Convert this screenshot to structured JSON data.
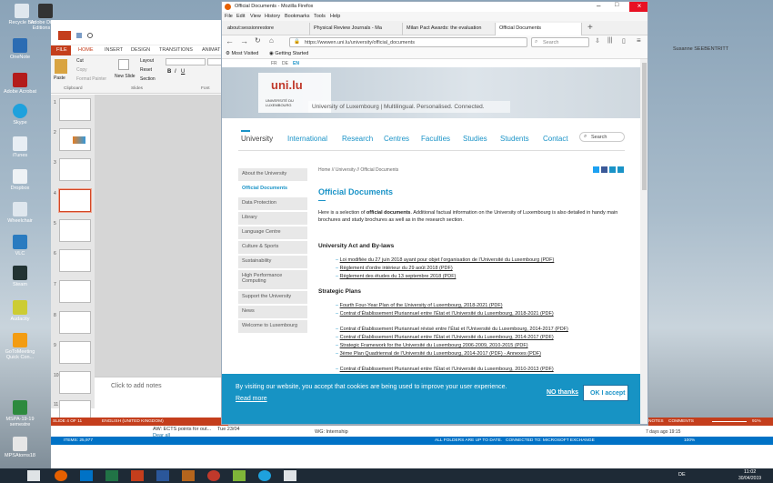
{
  "desktop": {
    "icons": [
      "Recycle Bin",
      "Adobe Digital Editions 4.5",
      "OneNote",
      "Adobe Acrobat",
      "Skype",
      "iTunes",
      "Dropbox",
      "Wheelchair",
      "VLC",
      "Steam",
      "Audacity",
      "GoToMeeting Quick Con...",
      "MSPA-19-19 semestre",
      "MPSAtorns18"
    ]
  },
  "ppt": {
    "tabs": [
      "FILE",
      "HOME",
      "INSERT",
      "DESIGN",
      "TRANSITIONS",
      "ANIMAT"
    ],
    "ribbon": {
      "paste": "Paste",
      "cut": "Cut",
      "copy": "Copy",
      "format_painter": "Format Painter",
      "new_slide": "New Slide",
      "layout": "Layout",
      "reset": "Reset",
      "section": "Section",
      "clipboard": "Clipboard",
      "slides": "Slides",
      "font": "Font"
    },
    "slide_numbers": [
      "1",
      "2",
      "3",
      "4",
      "5",
      "6",
      "7",
      "8",
      "9",
      "10",
      "11"
    ],
    "notes": "Click to add notes",
    "status": {
      "slide": "SLIDE 4 OF 11",
      "lang": "ENGLISH (UNITED KINGDOM)"
    }
  },
  "firefox": {
    "title": "Official Documents - Mozilla Firefox",
    "menu": [
      "File",
      "Edit",
      "View",
      "History",
      "Bookmarks",
      "Tools",
      "Help"
    ],
    "tabs": [
      "about:sessionrestore",
      "Physical Review Journals - Ma",
      "Milan Pact Awards: the evaluation",
      "Official Documents"
    ],
    "url": "https://wwwen.uni.lu/university/official_documents",
    "search_placeholder": "Search",
    "bookmarks": [
      "Most Visited",
      "Getting Started"
    ],
    "account": "Susanne SEEBENTRITT"
  },
  "site": {
    "langs": [
      "FR",
      "DE",
      "EN"
    ],
    "logo": "uni.lu",
    "logo_sub": "UNIVERSITÉ DU LUXEMBOURG",
    "tagline": "University of Luxembourg | Multilingual. Personalised. Connected.",
    "nav": [
      "University",
      "International",
      "Research",
      "Centres",
      "Faculties",
      "Studies",
      "Students",
      "Contact"
    ],
    "search": "Search",
    "sidebar": [
      "About the University",
      "Official Documents",
      "Data Protection",
      "Library",
      "Language Centre",
      "Culture & Sports",
      "Sustainability",
      "High Performance Computing",
      "Support the University",
      "News",
      "Welcome to Luxembourg"
    ],
    "breadcrumb": "Home // University // Official Documents",
    "heading": "Official Documents",
    "intro_a": "Here is a selection of ",
    "intro_b": "official documents",
    "intro_c": ". Additional factual information on the University of Luxembourg is also detailed in handy main brochures and study brochures as well as in the research section.",
    "h_act": "University Act and By-laws",
    "act_docs": [
      "Loi modifiée du 27 juin 2018 ayant pour objet l’organisation de l’Université du Luxembourg (PDF)",
      "Règlement d’ordre intérieur du 29 août 2018 (PDF)",
      "Règlement des études du 13 septembre 2018 (PDF)"
    ],
    "h_plans": "Strategic Plans",
    "plan_docs": [
      "Fourth Four-Year Plan of the University of Luxembourg, 2018-2021 (PDF)",
      "Contrat d’Établissement Pluriannuel entre l’État et l’Université du Luxembourg, 2018-2021 (PDF)",
      "Contrat d’Établissement Pluriannuel révisé entre l’État et l’Université du Luxembourg, 2014-2017 (PDF)",
      "Contrat d’Établissement Pluriannuel entre l’État et l’Université du Luxembourg, 2014-2017 (PDF)",
      "Strategic Framework for the Université du Luxembourg 2006-2009, 2010-2015 (PDF)",
      "3ème Plan Quadriennal de l’Université du Luxembourg, 2014-2017 (PDF) - Annexes (PDF)",
      "Contrat d’Établissement Pluriannuel entre l’État et l’Université du Luxembourg, 2010-2013 (PDF)"
    ],
    "cookie": {
      "text": "By visiting our website, you accept that cookies are being used to improve your user experience.",
      "more": "Read more",
      "no": "NO thanks",
      "ok": "OK I accept"
    }
  },
  "outlook": {
    "rows": [
      "AW: ECTS points for out...",
      "Dear all",
      "WG: Internship"
    ],
    "date": "Tue 23/04",
    "items": "ITEMS: 25,977",
    "status": "ALL FOLDERS ARE UP TO DATE.",
    "conn": "CONNECTED TO: MICROSOFT EXCHANGE",
    "reminder": "7 days ago 19:15",
    "zoom": "100%"
  },
  "ppt_status2": {
    "notes": "NOTES",
    "comments": "COMMENTS",
    "zoom": "91%"
  },
  "taskbar": {
    "time": "11:02",
    "date": "30/04/2019",
    "lang": "DE"
  }
}
